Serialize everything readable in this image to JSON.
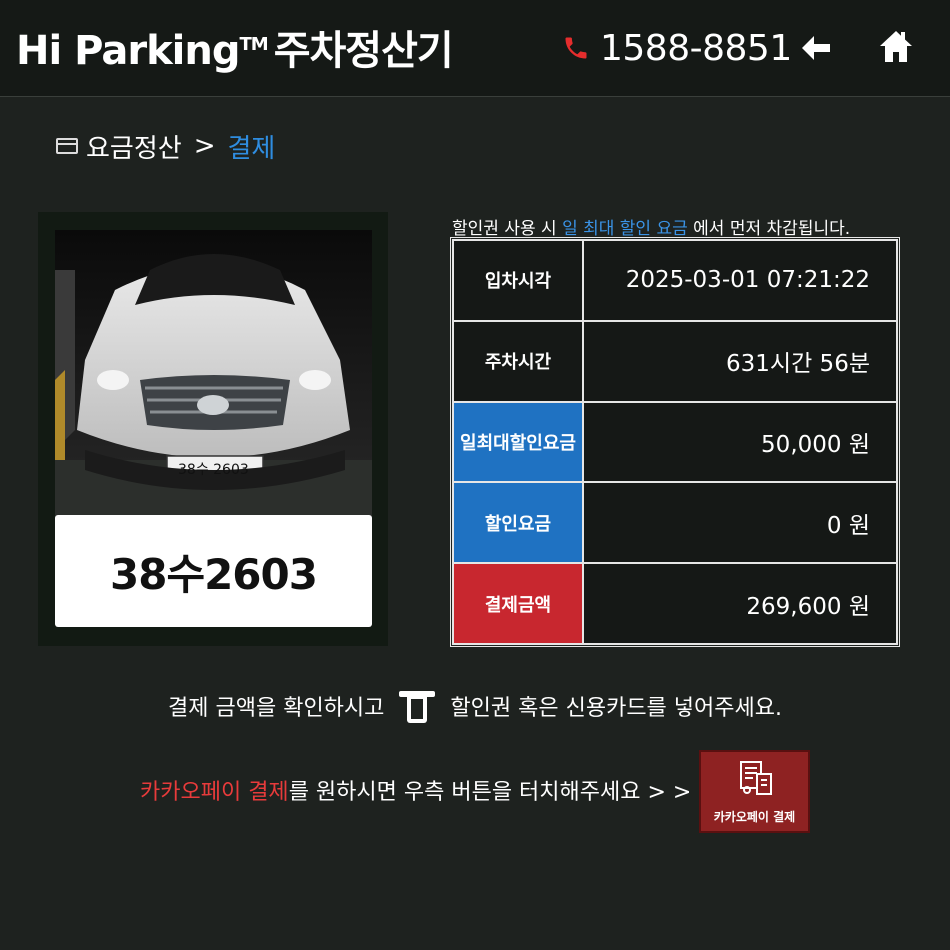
{
  "header": {
    "title": "Hi Parking",
    "trademark": "TM",
    "subtitle": "주차정산기",
    "phone": "1588-8851"
  },
  "breadcrumb": {
    "step1": "요금정산",
    "separator": ">",
    "step2": "결제"
  },
  "car": {
    "plate_in_photo": "38수 2603",
    "plate_number": "38수2603"
  },
  "notice": {
    "prefix": "할인권 사용 시 ",
    "highlight": "일 최대 할인 요금",
    "suffix": " 에서 먼저 차감됩니다."
  },
  "info_table": [
    {
      "label": "입차시각",
      "value": "2025-03-01 07:21:22",
      "style": "plain"
    },
    {
      "label": "주차시간",
      "value": "631시간 56분",
      "style": "plain"
    },
    {
      "label": "일최대할인요금",
      "value": "50,000 원",
      "style": "blue"
    },
    {
      "label": "할인요금",
      "value": "0 원",
      "style": "blue"
    },
    {
      "label": "결제금액",
      "value": "269,600 원",
      "style": "red"
    }
  ],
  "instructions": {
    "line1_prefix": "결제 금액을 확인하시고",
    "line1_suffix": "할인권 혹은 신용카드를 넣어주세요.",
    "line2_red": "카카오페이 결제",
    "line2_rest": "를 원하시면 우측 버튼을 터치해주세요 >  >"
  },
  "kakao_button": {
    "label": "카카오페이 결제"
  },
  "colors": {
    "background": "#1e221f",
    "accent_blue": "#1f72c2",
    "accent_red": "#c8272f",
    "link_blue": "#2f8de0",
    "phone_red": "#e52d2d",
    "kakao_button": "#8e2222"
  }
}
